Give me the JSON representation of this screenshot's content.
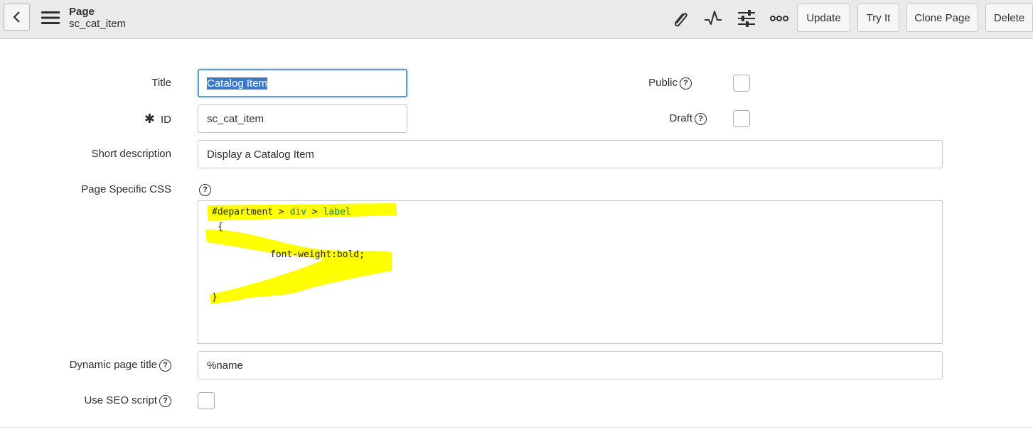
{
  "header": {
    "record_type": "Page",
    "record_id": "sc_cat_item",
    "buttons": {
      "update": "Update",
      "try_it": "Try It",
      "clone_page": "Clone Page",
      "delete": "Delete"
    }
  },
  "form": {
    "title_label": "Title",
    "title_value": "Catalog Item",
    "id_label": "ID",
    "id_required_mark": "✱",
    "id_value": "sc_cat_item",
    "public_label": "Public",
    "draft_label": "Draft",
    "short_description_label": "Short description",
    "short_description_value": "Display a Catalog Item",
    "page_css_label": "Page Specific CSS",
    "css_code": {
      "line1_selector": "#department > div > label",
      "line1_hash": "#department",
      "line1_gt1": " > ",
      "line1_div": "div",
      "line1_gt2": " > ",
      "line1_label": "label",
      "line2": "{",
      "line3": "font-weight:bold;",
      "line4": "}"
    },
    "dynamic_title_label": "Dynamic page title",
    "dynamic_title_value": "%name",
    "seo_label": "Use SEO script",
    "help_glyph": "?"
  },
  "highlight_color": "#ffff00"
}
